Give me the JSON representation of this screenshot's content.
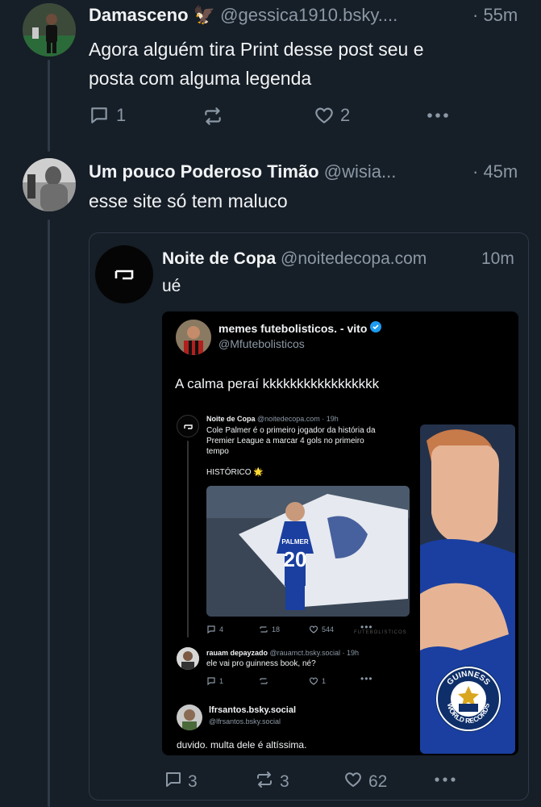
{
  "post1": {
    "display_name": "Damasceno",
    "name_emoji": "🦅",
    "handle": "@gessica1910.bsky....",
    "time": "· 55m",
    "text_line1": "Agora alguém tira Print desse post seu e",
    "text_line2": "posta com alguma legenda",
    "replies": "1",
    "likes": "2"
  },
  "post2": {
    "display_name": "Um pouco Poderoso Timão",
    "handle": "@wisia...",
    "time": "· 45m",
    "text": "esse site só tem maluco",
    "quote": {
      "display_name": "Noite de Copa",
      "handle": "@noitedecopa.com",
      "time": "10m",
      "text": "ué",
      "shot": {
        "name": "memes futebolisticos. - vito",
        "handle": "@Mfutebolisticos",
        "text": "A calma peraí kkkkkkkkkkkkkkkkk",
        "inner": {
          "name": "Noite de Copa",
          "handle": "@noitedecopa.com · 19h",
          "text1": "Cole Palmer é o primeiro jogador da história da",
          "text2": "Premier League a marcar 4 gols no primeiro",
          "text3": "tempo",
          "historic": "HISTÓRICO 🌟",
          "jersey_name": "PALMER",
          "jersey_number": "20",
          "replies": "4",
          "reposts": "18",
          "likes": "544",
          "watermark": "FUTEBOLISTICOS"
        },
        "reply1": {
          "name": "rauam depayzado",
          "handle": "@rauamct.bsky.social · 19h",
          "text": "ele vai pro guinness book, né?",
          "replies": "1",
          "likes": "1"
        },
        "reply2": {
          "name": "lfrsantos.bsky.social",
          "handle": "@lfrsantos.bsky.social",
          "text": "duvido. multa dele é altíssima."
        },
        "badge_top": "GUINNESS",
        "badge_bottom": "WORLD RECORDS"
      }
    },
    "replies": "3",
    "reposts": "3",
    "likes": "62"
  },
  "colors": {
    "background": "#161e27",
    "text": "#f1f3f5",
    "muted": "#8b98a5",
    "border": "#2e3a47",
    "verified": "#1d9bf0",
    "chelsea_blue": "#1a3fa0"
  }
}
